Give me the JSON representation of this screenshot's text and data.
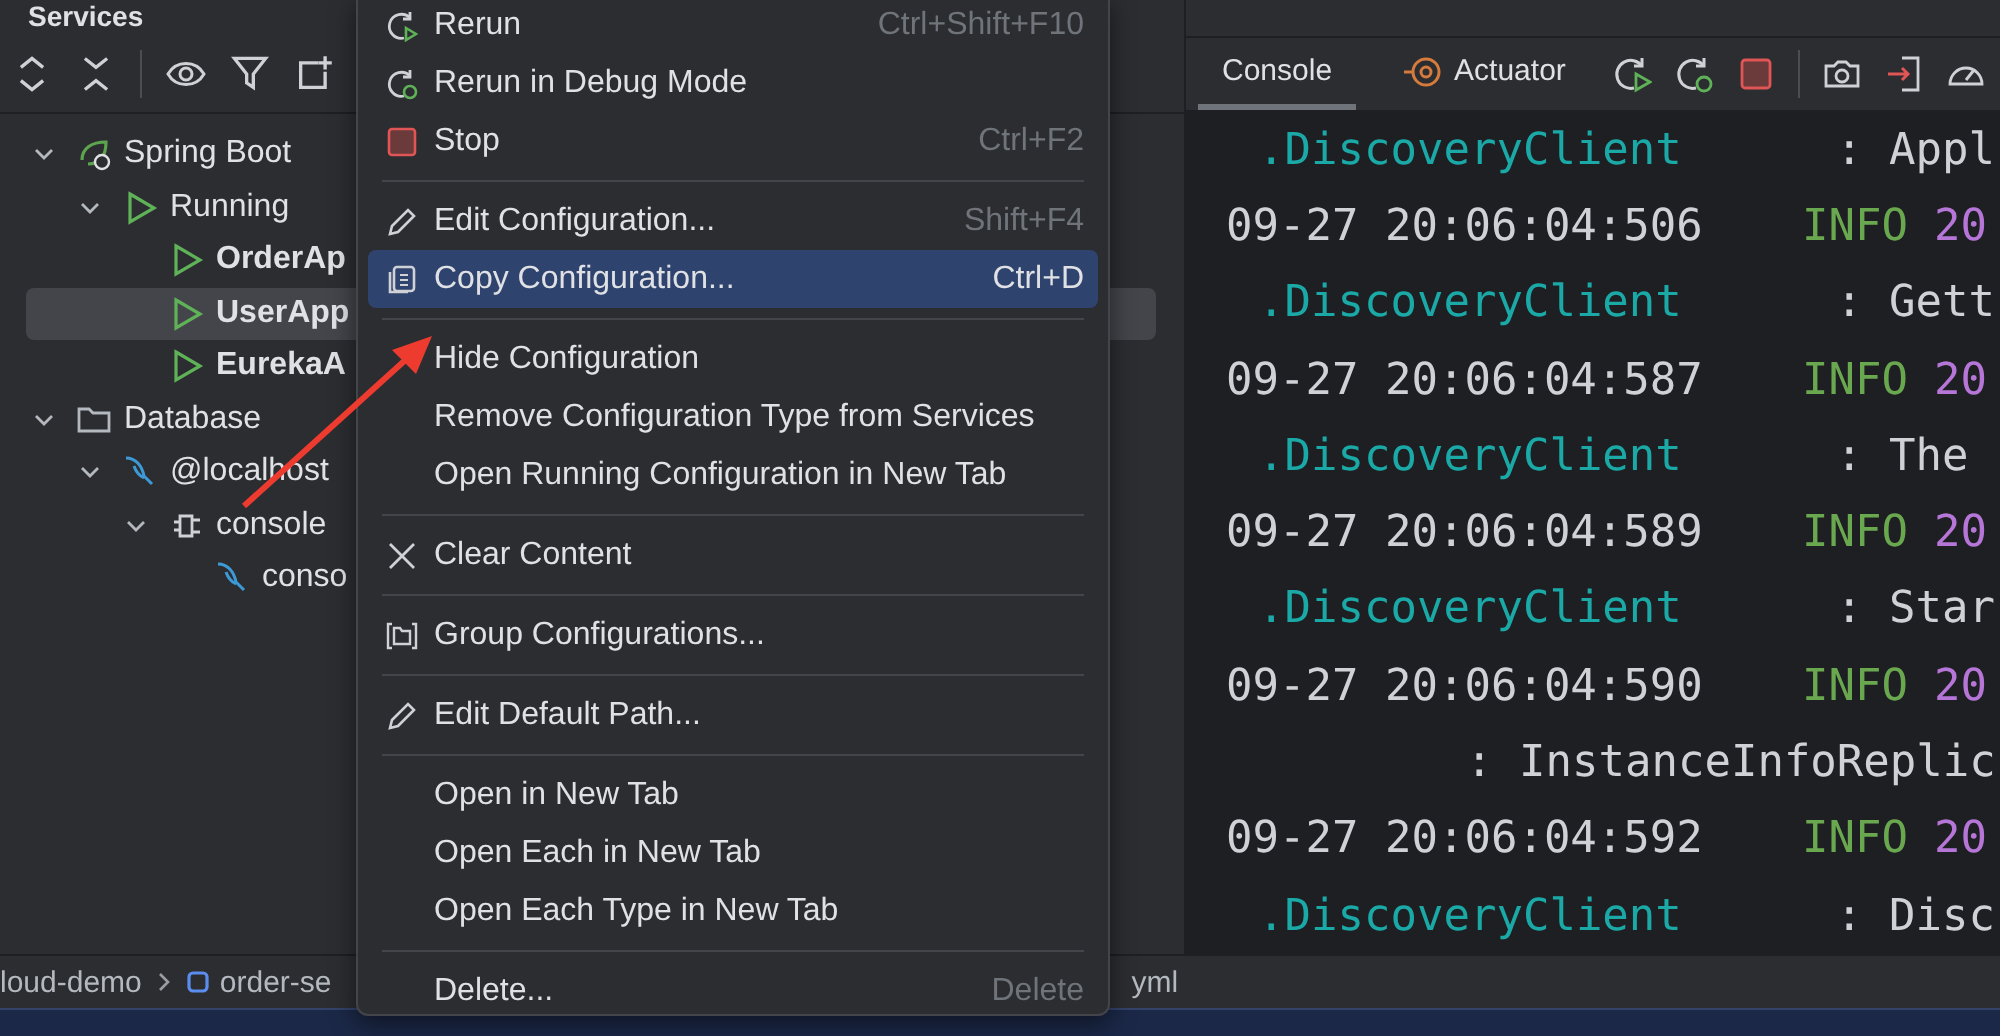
{
  "panel_title": "Services",
  "tree": [
    {
      "label": "Spring Boot",
      "kind": "spring",
      "expanded": true,
      "selected": false,
      "children": [
        {
          "label": "Running",
          "kind": "group",
          "expanded": true,
          "selected": false,
          "children": [
            {
              "label": "OrderAp",
              "kind": "app",
              "selected": false
            },
            {
              "label": "UserApp",
              "kind": "app",
              "selected": true
            },
            {
              "label": "EurekaA",
              "kind": "app",
              "selected": false
            }
          ]
        }
      ]
    },
    {
      "label": "Database",
      "kind": "folder",
      "expanded": true,
      "selected": false,
      "children": [
        {
          "label": "@localhost",
          "kind": "db",
          "expanded": true,
          "selected": false,
          "children": [
            {
              "label": "console",
              "kind": "session",
              "expanded": true,
              "selected": false,
              "children": [
                {
                  "label": "conso",
                  "kind": "db",
                  "selected": false
                }
              ]
            }
          ]
        }
      ]
    }
  ],
  "breadcrumb": {
    "items": [
      "loud-demo",
      "order-se"
    ],
    "tail": "yml"
  },
  "console_tabs": [
    {
      "label": "Console",
      "selected": true
    },
    {
      "label": "Actuator",
      "selected": false
    }
  ],
  "console_lines": [
    {
      "kind": "source",
      "source": ".DiscoveryClient",
      "message": ": Appl"
    },
    {
      "kind": "entry",
      "time": "09-27 20:06:04:506",
      "level": "INFO",
      "thread": "20"
    },
    {
      "kind": "source",
      "source": ".DiscoveryClient",
      "message": ": Gett"
    },
    {
      "kind": "entry",
      "time": "09-27 20:06:04:587",
      "level": "INFO",
      "thread": "20"
    },
    {
      "kind": "source",
      "source": ".DiscoveryClient",
      "message": ": The"
    },
    {
      "kind": "entry",
      "time": "09-27 20:06:04:589",
      "level": "INFO",
      "thread": "20"
    },
    {
      "kind": "source",
      "source": ".DiscoveryClient",
      "message": ": Star"
    },
    {
      "kind": "entry",
      "time": "09-27 20:06:04:590",
      "level": "INFO",
      "thread": "20"
    },
    {
      "kind": "message",
      "message": ": InstanceInfoReplic"
    },
    {
      "kind": "entry",
      "time": "09-27 20:06:04:592",
      "level": "INFO",
      "thread": "20"
    },
    {
      "kind": "source",
      "source": ".DiscoveryClient",
      "message": ": Disc"
    }
  ],
  "context_menu": [
    {
      "kind": "rerun",
      "label": "Rerun",
      "shortcut": "Ctrl+Shift+F10",
      "selected": false
    },
    {
      "kind": "debug",
      "label": "Rerun in Debug Mode",
      "selected": false
    },
    {
      "kind": "stop",
      "label": "Stop",
      "shortcut": "Ctrl+F2",
      "selected": false
    },
    {
      "kind": "separator"
    },
    {
      "kind": "edit",
      "label": "Edit Configuration...",
      "shortcut": "Shift+F4",
      "selected": false
    },
    {
      "kind": "copy",
      "label": "Copy Configuration...",
      "shortcut": "Ctrl+D",
      "selected": true
    },
    {
      "kind": "separator"
    },
    {
      "kind": "plain",
      "label": "Hide Configuration",
      "selected": false
    },
    {
      "kind": "plain",
      "label": "Remove Configuration Type from Services",
      "selected": false
    },
    {
      "kind": "plain",
      "label": "Open Running Configuration in New Tab",
      "selected": false
    },
    {
      "kind": "separator"
    },
    {
      "kind": "clear",
      "label": "Clear Content",
      "selected": false
    },
    {
      "kind": "separator"
    },
    {
      "kind": "group",
      "label": "Group Configurations...",
      "selected": false
    },
    {
      "kind": "separator"
    },
    {
      "kind": "edit",
      "label": "Edit Default Path...",
      "selected": false
    },
    {
      "kind": "separator"
    },
    {
      "kind": "plain",
      "label": "Open in New Tab",
      "selected": false
    },
    {
      "kind": "plain",
      "label": "Open Each in New Tab",
      "selected": false
    },
    {
      "kind": "plain",
      "label": "Open Each Type in New Tab",
      "selected": false
    },
    {
      "kind": "separator"
    },
    {
      "kind": "plain",
      "label": "Delete...",
      "shortcut": "Delete",
      "selected": false
    }
  ]
}
